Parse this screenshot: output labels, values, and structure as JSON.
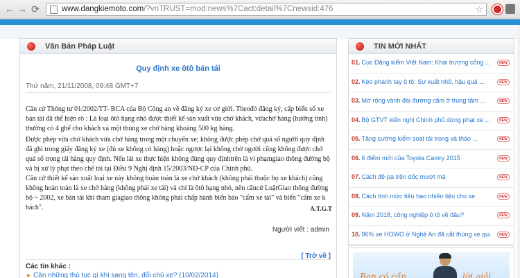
{
  "browser": {
    "url_host": "www.dangkiemoto.com",
    "url_rest": "/?vnTRUST=mod:news%7Cact:detail%7Cnewsid:476"
  },
  "main": {
    "panel_title": "Văn Bản Pháp Luật",
    "article_title": "Quy định xe ôtô bán tải",
    "meta": "Thứ năm, 21/11/2008, 09:48 GMT+7",
    "paragraphs": [
      "Căn cứ Thông tư 01/2002/TT- BCA của Bộ Công an về đăng ký xe cơ giới. Theođó đăng ký, cấp biển số xe bán tải đã thể hiện rõ : Là loại ôtô hạng nhỏ được thiết kế sản xuất vừa chở khách, vừachở hàng (hướng tính) thường có 4 ghế cho khách và một thùng xe chở hàng khoảng 500 kg hàng.",
      "Được phép vừa chở khách vừa chở hàng trong một chuyến xe; không được phép chở quá số người quy định đã ghi trong giấy đăng ký xe (đủ xe không có hàng) hoặc ngược lại không chở người cũng không được chở quá số trọng tải hàng quy định. Nếu lái xe thực hiện không đúng quy địnhtrên là vi phạmgiao thông đường bộ và bị xử lý phạt theo chế tài tại Điều 9 Nghị định 15/2003/NĐ-CP của Chính phủ.",
      "Căn cứ thiết kế sản xuất loại xe này không hoàn toàn là xe chở khách (không phải thuộc họ xe khách) cũng không hoàn toàn là xe chở hàng (không phải xe tải) và chỉ là ôtô hạng nhỏ, nên căncứ LuậtGiao thông đường bộ ~ 2002, xe bán tải khi tham giagiao thông không phải chấp hành biển báo \"cấm xe tải\" và biển \"cấm xe k hách\"."
    ],
    "signature": "A.T.G.T",
    "author": "Người viết : admin",
    "back_label": "[ Trở về ]",
    "other_heading": "Các tin khác :",
    "other_items": [
      "Cần những thủ tục gì khi sang tên, đổi chủ xe? (10/02/2014)"
    ]
  },
  "sidebar": {
    "title": "TIN MỚI NHẤT",
    "badge_label": "NEW",
    "items": [
      {
        "num": "01.",
        "text": "Cục Đăng kiểm Việt Nam: Khai trương cổng ..."
      },
      {
        "num": "02.",
        "text": "Kéo phanh tay ô tô: Sự xuất nhỏ, hậu quả ..."
      },
      {
        "num": "03.",
        "text": "Mờ rộng vành đai đường cấm ở trung tâm ..."
      },
      {
        "num": "04.",
        "text": "Bộ GTVT kiến nghị Chính phủ dừng phạt xe ..."
      },
      {
        "num": "05.",
        "text": "Tăng cường kiểm soát tải trọng và tháo ..."
      },
      {
        "num": "06.",
        "text": "6 điểm mới của Toyota Camry 2015"
      },
      {
        "num": "07.",
        "text": "Cách đề-pa trên dốc mượt mà"
      },
      {
        "num": "08.",
        "text": "Cách tính mức tiêu hao nhiên liệu cho xe"
      },
      {
        "num": "09.",
        "text": "Năm 2018, công nghiệp ô tô về đâu?"
      },
      {
        "num": "10.",
        "text": "96% xe HOWO ở Nghệ An đã cắt thùng xe quá ..."
      }
    ]
  },
  "ad": {
    "text_left": "Bạn có cần",
    "text_right": "lời giải"
  }
}
